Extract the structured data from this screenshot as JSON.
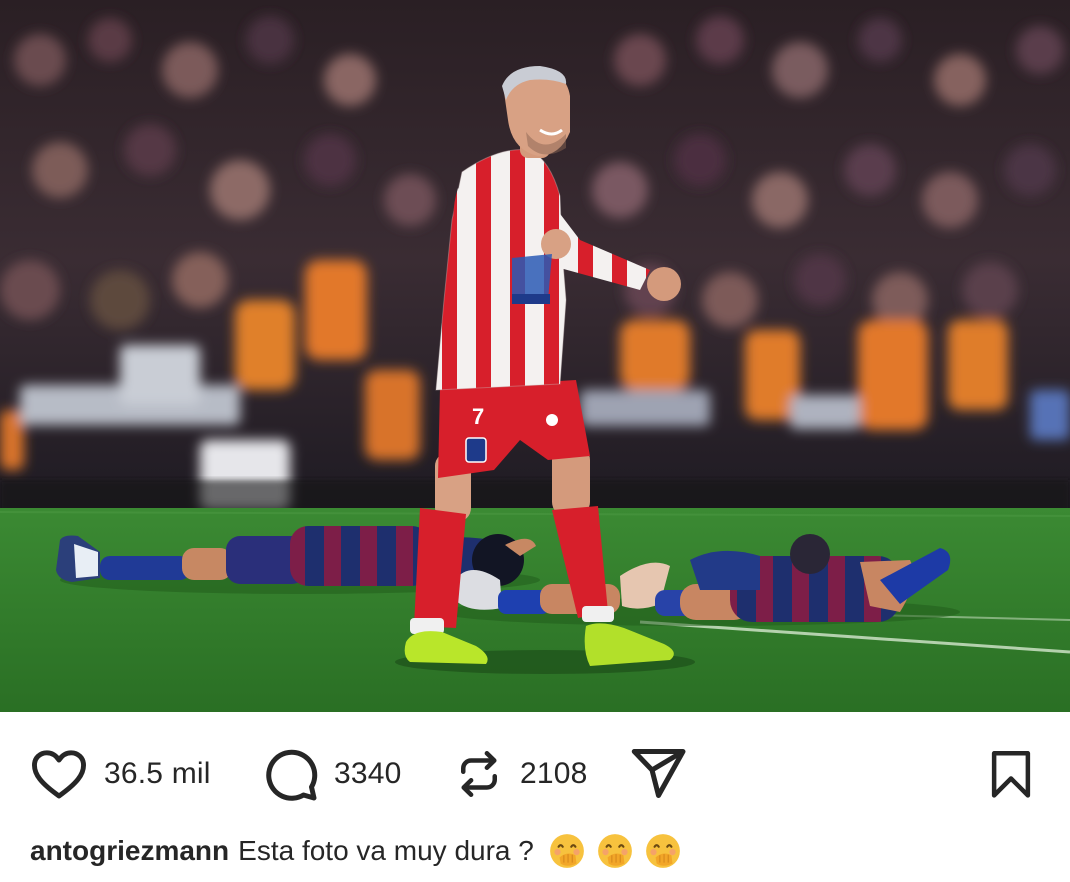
{
  "post": {
    "username": "antogriezmann",
    "caption": "Esta foto va muy dura ?",
    "caption_emojis": [
      "hand-over-mouth-emoji",
      "hand-over-mouth-emoji",
      "hand-over-mouth-emoji"
    ],
    "image": {
      "player_shirt_number": "7"
    }
  },
  "actions": {
    "like": {
      "icon": "heart-icon",
      "count": "36.5 mil"
    },
    "comment": {
      "icon": "comment-bubble-icon",
      "count": "3340"
    },
    "repost": {
      "icon": "repost-icon",
      "count": "2108"
    },
    "share": {
      "icon": "send-paper-plane-icon"
    },
    "save": {
      "icon": "bookmark-icon"
    }
  },
  "colors": {
    "text": "#262626",
    "pitch": "#2f7f2a",
    "atletico_red": "#d71f2b",
    "barca_blue": "#1e2f6e",
    "barca_garnet": "#8a1f4a",
    "boot_green": "#b9e62a"
  }
}
